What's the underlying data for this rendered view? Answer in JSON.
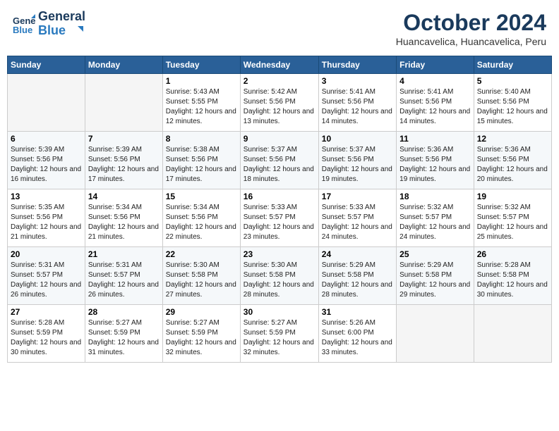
{
  "header": {
    "logo_line1": "General",
    "logo_line2": "Blue",
    "month_year": "October 2024",
    "location": "Huancavelica, Huancavelica, Peru"
  },
  "weekdays": [
    "Sunday",
    "Monday",
    "Tuesday",
    "Wednesday",
    "Thursday",
    "Friday",
    "Saturday"
  ],
  "weeks": [
    [
      null,
      null,
      {
        "day": "1",
        "sunrise": "5:43 AM",
        "sunset": "5:55 PM",
        "daylight": "12 hours and 12 minutes."
      },
      {
        "day": "2",
        "sunrise": "5:42 AM",
        "sunset": "5:56 PM",
        "daylight": "12 hours and 13 minutes."
      },
      {
        "day": "3",
        "sunrise": "5:41 AM",
        "sunset": "5:56 PM",
        "daylight": "12 hours and 14 minutes."
      },
      {
        "day": "4",
        "sunrise": "5:41 AM",
        "sunset": "5:56 PM",
        "daylight": "12 hours and 14 minutes."
      },
      {
        "day": "5",
        "sunrise": "5:40 AM",
        "sunset": "5:56 PM",
        "daylight": "12 hours and 15 minutes."
      }
    ],
    [
      {
        "day": "6",
        "sunrise": "5:39 AM",
        "sunset": "5:56 PM",
        "daylight": "12 hours and 16 minutes."
      },
      {
        "day": "7",
        "sunrise": "5:39 AM",
        "sunset": "5:56 PM",
        "daylight": "12 hours and 17 minutes."
      },
      {
        "day": "8",
        "sunrise": "5:38 AM",
        "sunset": "5:56 PM",
        "daylight": "12 hours and 17 minutes."
      },
      {
        "day": "9",
        "sunrise": "5:37 AM",
        "sunset": "5:56 PM",
        "daylight": "12 hours and 18 minutes."
      },
      {
        "day": "10",
        "sunrise": "5:37 AM",
        "sunset": "5:56 PM",
        "daylight": "12 hours and 19 minutes."
      },
      {
        "day": "11",
        "sunrise": "5:36 AM",
        "sunset": "5:56 PM",
        "daylight": "12 hours and 19 minutes."
      },
      {
        "day": "12",
        "sunrise": "5:36 AM",
        "sunset": "5:56 PM",
        "daylight": "12 hours and 20 minutes."
      }
    ],
    [
      {
        "day": "13",
        "sunrise": "5:35 AM",
        "sunset": "5:56 PM",
        "daylight": "12 hours and 21 minutes."
      },
      {
        "day": "14",
        "sunrise": "5:34 AM",
        "sunset": "5:56 PM",
        "daylight": "12 hours and 21 minutes."
      },
      {
        "day": "15",
        "sunrise": "5:34 AM",
        "sunset": "5:56 PM",
        "daylight": "12 hours and 22 minutes."
      },
      {
        "day": "16",
        "sunrise": "5:33 AM",
        "sunset": "5:57 PM",
        "daylight": "12 hours and 23 minutes."
      },
      {
        "day": "17",
        "sunrise": "5:33 AM",
        "sunset": "5:57 PM",
        "daylight": "12 hours and 24 minutes."
      },
      {
        "day": "18",
        "sunrise": "5:32 AM",
        "sunset": "5:57 PM",
        "daylight": "12 hours and 24 minutes."
      },
      {
        "day": "19",
        "sunrise": "5:32 AM",
        "sunset": "5:57 PM",
        "daylight": "12 hours and 25 minutes."
      }
    ],
    [
      {
        "day": "20",
        "sunrise": "5:31 AM",
        "sunset": "5:57 PM",
        "daylight": "12 hours and 26 minutes."
      },
      {
        "day": "21",
        "sunrise": "5:31 AM",
        "sunset": "5:57 PM",
        "daylight": "12 hours and 26 minutes."
      },
      {
        "day": "22",
        "sunrise": "5:30 AM",
        "sunset": "5:58 PM",
        "daylight": "12 hours and 27 minutes."
      },
      {
        "day": "23",
        "sunrise": "5:30 AM",
        "sunset": "5:58 PM",
        "daylight": "12 hours and 28 minutes."
      },
      {
        "day": "24",
        "sunrise": "5:29 AM",
        "sunset": "5:58 PM",
        "daylight": "12 hours and 28 minutes."
      },
      {
        "day": "25",
        "sunrise": "5:29 AM",
        "sunset": "5:58 PM",
        "daylight": "12 hours and 29 minutes."
      },
      {
        "day": "26",
        "sunrise": "5:28 AM",
        "sunset": "5:58 PM",
        "daylight": "12 hours and 30 minutes."
      }
    ],
    [
      {
        "day": "27",
        "sunrise": "5:28 AM",
        "sunset": "5:59 PM",
        "daylight": "12 hours and 30 minutes."
      },
      {
        "day": "28",
        "sunrise": "5:27 AM",
        "sunset": "5:59 PM",
        "daylight": "12 hours and 31 minutes."
      },
      {
        "day": "29",
        "sunrise": "5:27 AM",
        "sunset": "5:59 PM",
        "daylight": "12 hours and 32 minutes."
      },
      {
        "day": "30",
        "sunrise": "5:27 AM",
        "sunset": "5:59 PM",
        "daylight": "12 hours and 32 minutes."
      },
      {
        "day": "31",
        "sunrise": "5:26 AM",
        "sunset": "6:00 PM",
        "daylight": "12 hours and 33 minutes."
      },
      null,
      null
    ]
  ],
  "labels": {
    "sunrise_prefix": "Sunrise: ",
    "sunset_prefix": "Sunset: ",
    "daylight_prefix": "Daylight: "
  }
}
